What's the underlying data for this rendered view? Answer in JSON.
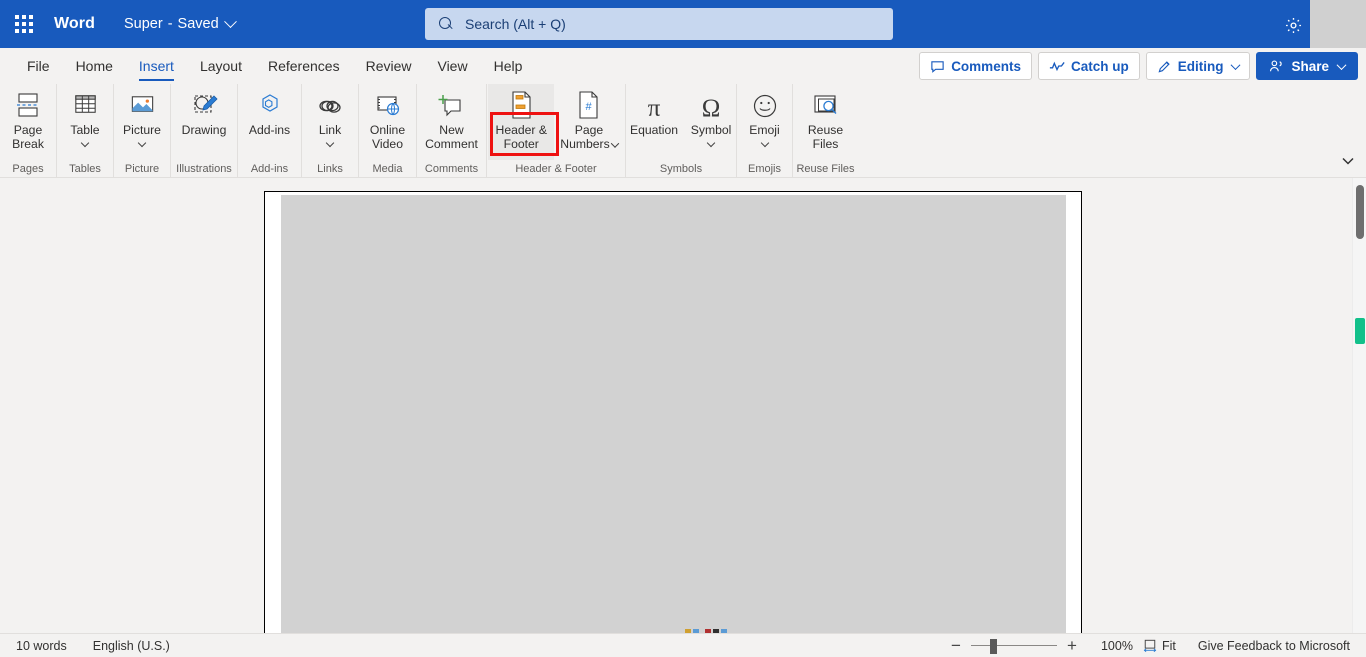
{
  "titlebar": {
    "waffle_icon": "app-launcher-icon",
    "app_name": "Word",
    "doc_name": "Super",
    "doc_separator": "-",
    "doc_state": "Saved",
    "gear_icon": "gear-icon"
  },
  "search": {
    "icon": "search-icon",
    "placeholder": "Search (Alt + Q)",
    "value": "Search (Alt + Q)"
  },
  "menubar": {
    "tabs": [
      {
        "label": "File",
        "active": false
      },
      {
        "label": "Home",
        "active": false
      },
      {
        "label": "Insert",
        "active": true
      },
      {
        "label": "Layout",
        "active": false
      },
      {
        "label": "References",
        "active": false
      },
      {
        "label": "Review",
        "active": false
      },
      {
        "label": "View",
        "active": false
      },
      {
        "label": "Help",
        "active": false
      }
    ],
    "comments_label": "Comments",
    "catchup_label": "Catch up",
    "editing_label": "Editing",
    "share_label": "Share"
  },
  "ribbon": {
    "groups": [
      {
        "name": "Pages",
        "items": [
          {
            "label": "Page\nBreak",
            "icon": "page-break-icon",
            "has_chevron": false
          }
        ]
      },
      {
        "name": "Tables",
        "items": [
          {
            "label": "Table",
            "icon": "table-icon",
            "has_chevron": true
          }
        ]
      },
      {
        "name": "Picture",
        "items": [
          {
            "label": "Picture",
            "icon": "picture-icon",
            "has_chevron": true
          }
        ]
      },
      {
        "name": "Illustrations",
        "items": [
          {
            "label": "Drawing",
            "icon": "drawing-icon",
            "has_chevron": false
          }
        ]
      },
      {
        "name": "Add-ins",
        "items": [
          {
            "label": "Add-ins",
            "icon": "addins-icon",
            "has_chevron": false
          }
        ]
      },
      {
        "name": "Links",
        "items": [
          {
            "label": "Link",
            "icon": "link-icon",
            "has_chevron": true
          }
        ]
      },
      {
        "name": "Media",
        "items": [
          {
            "label": "Online\nVideo",
            "icon": "online-video-icon",
            "has_chevron": false
          }
        ]
      },
      {
        "name": "Comments",
        "items": [
          {
            "label": "New\nComment",
            "icon": "new-comment-icon",
            "has_chevron": false
          }
        ]
      },
      {
        "name": "Header & Footer",
        "items": [
          {
            "label": "Header &\nFooter",
            "icon": "header-footer-icon",
            "has_chevron": false,
            "highlighted": true
          },
          {
            "label": "Page\nNumbers",
            "icon": "page-numbers-icon",
            "has_chevron": true,
            "chevron_inline": true
          }
        ]
      },
      {
        "name": "Symbols",
        "items": [
          {
            "label": "Equation",
            "icon": "equation-pi-icon",
            "has_chevron": false
          },
          {
            "label": "Symbol",
            "icon": "symbol-omega-icon",
            "has_chevron": true
          }
        ]
      },
      {
        "name": "Emojis",
        "items": [
          {
            "label": "Emoji",
            "icon": "emoji-smiley-icon",
            "has_chevron": true
          }
        ]
      },
      {
        "name": "Reuse Files",
        "items": [
          {
            "label": "Reuse\nFiles",
            "icon": "reuse-files-icon",
            "has_chevron": false
          }
        ]
      }
    ],
    "expand_icon": "chevron-down-icon",
    "highlight_color": "#ee1111"
  },
  "statusbar": {
    "word_count": "10 words",
    "language": "English (U.S.)",
    "zoom_out_label": "−",
    "zoom_in_label": "+",
    "zoom_percent": "100%",
    "fit_label": "Fit",
    "fit_icon": "fit-page-icon",
    "feedback_label": "Give Feedback to Microsoft"
  },
  "scrollbar": {
    "thumb_name": "vertical-scroll-thumb",
    "marker_color": "#12c08a"
  },
  "colors": {
    "brand_blue": "#185abd",
    "chrome_gray": "#f3f2f1",
    "selection_gray": "#d2d2d2"
  }
}
